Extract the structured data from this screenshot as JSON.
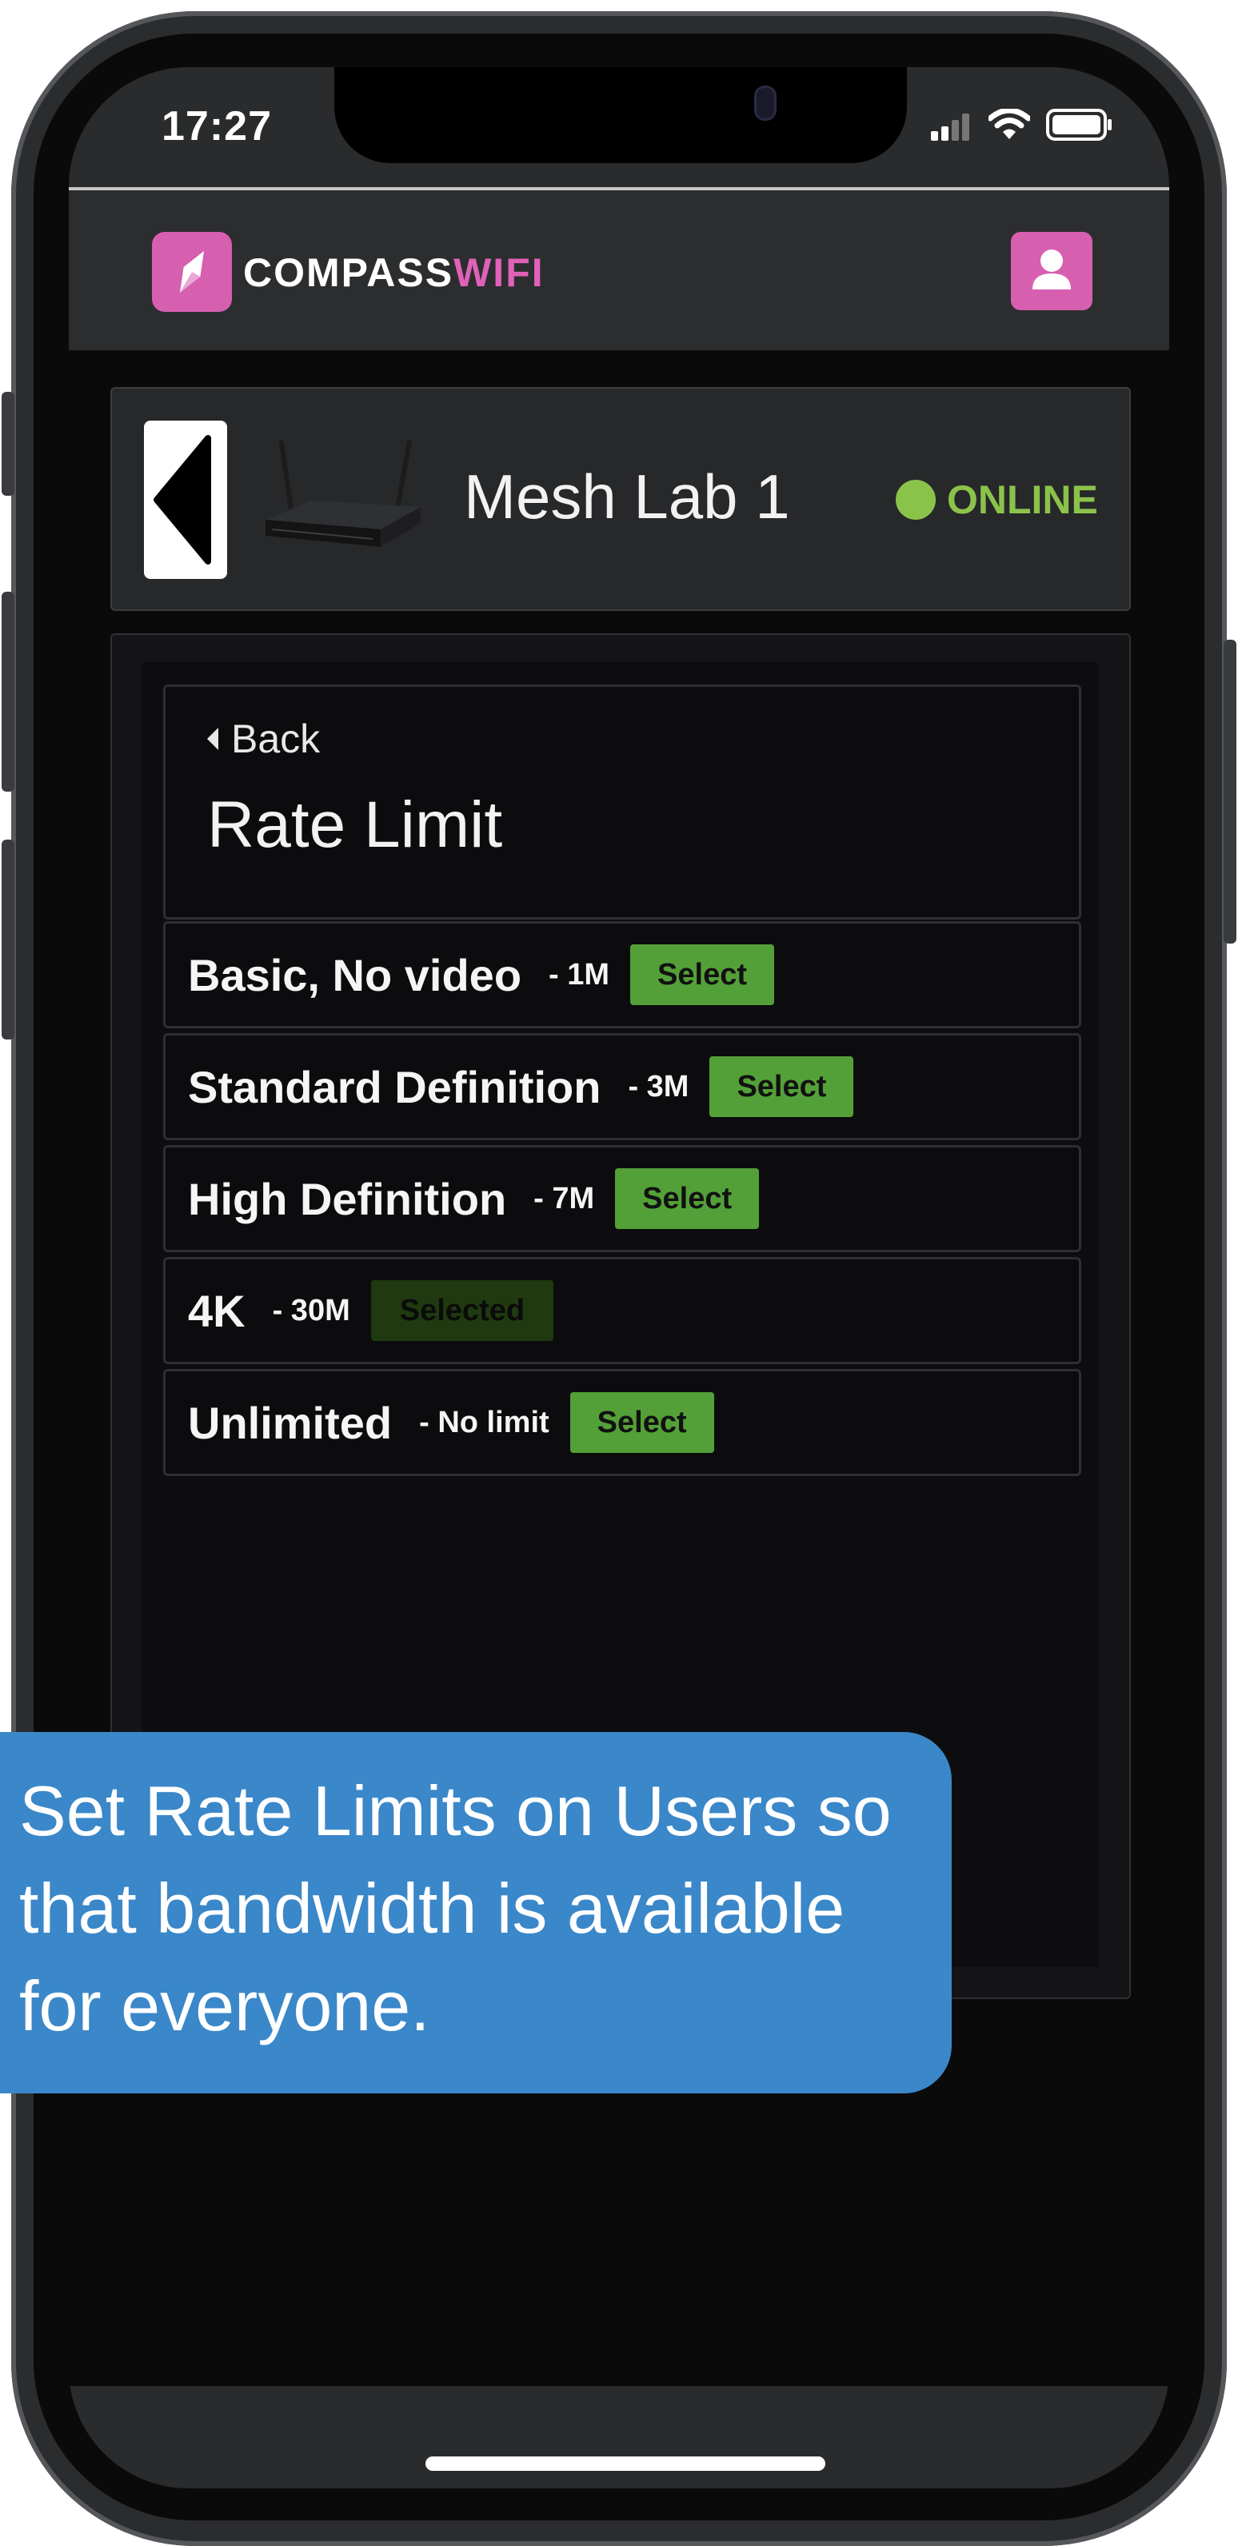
{
  "status_bar": {
    "time": "17:27"
  },
  "header": {
    "logo_part1": "COMPASS",
    "logo_part2": "WIFI"
  },
  "device": {
    "name": "Mesh Lab 1",
    "status": "ONLINE"
  },
  "rate_limit": {
    "back_label": "Back",
    "title": "Rate Limit",
    "options": [
      {
        "name": "Basic, No video",
        "speed": "- 1M",
        "button": "Select"
      },
      {
        "name": "Standard Definition",
        "speed": "- 3M",
        "button": "Select"
      },
      {
        "name": "High Definition",
        "speed": "- 7M",
        "button": "Select"
      },
      {
        "name": "4K",
        "speed": "- 30M",
        "button": "Selected"
      },
      {
        "name": "Unlimited",
        "speed": "- No limit",
        "button": "Select"
      }
    ]
  },
  "callout": {
    "text": "Set Rate Limits on Users so that bandwidth is available for everyone."
  },
  "colors": {
    "brand_pink": "#d65fb0",
    "online_green": "#8bc34a",
    "select_green": "#54a038",
    "callout_blue": "#3a87c9"
  }
}
